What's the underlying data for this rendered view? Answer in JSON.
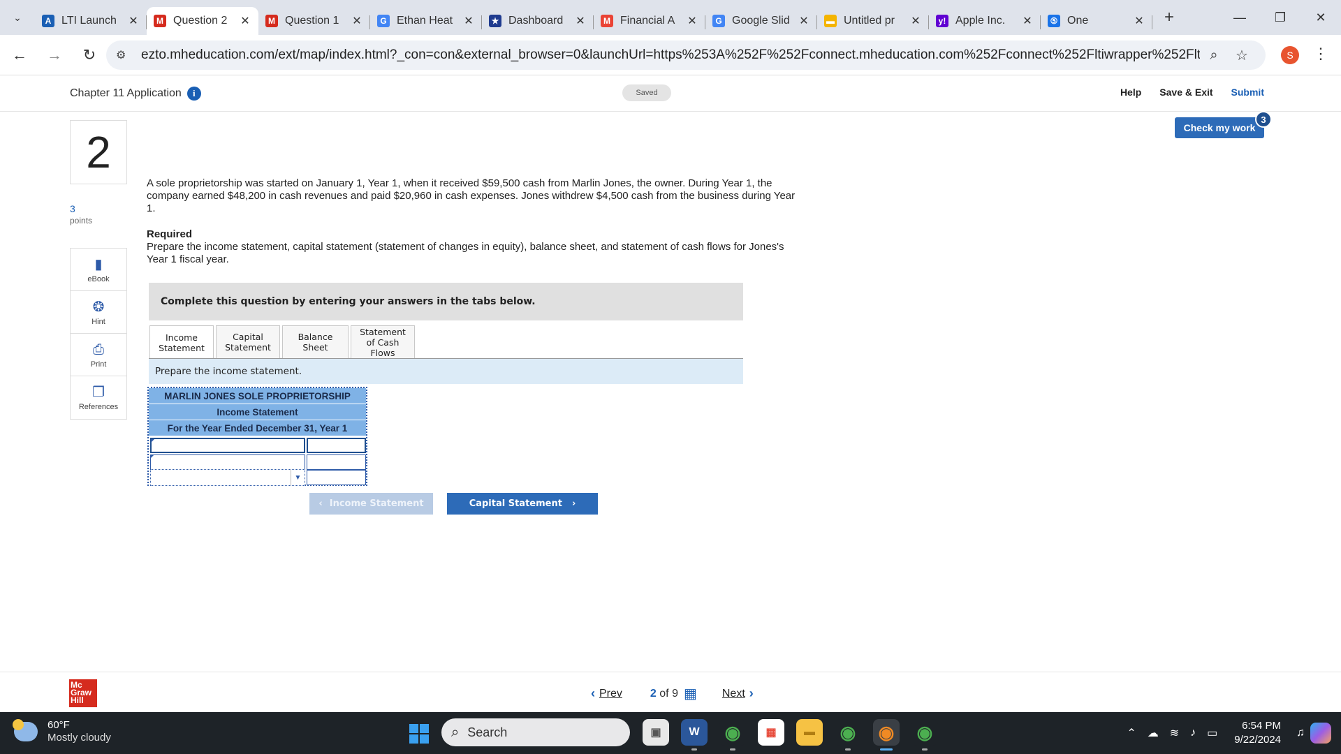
{
  "browser": {
    "tabs": [
      {
        "label": "LTI Launch",
        "icon": "lti-favicon",
        "color": "#1a5fb4",
        "glyph": "A",
        "active": false
      },
      {
        "label": "Question 2",
        "icon": "mheducation-favicon",
        "color": "#d52b1e",
        "glyph": "M",
        "active": true
      },
      {
        "label": "Question 1",
        "icon": "mheducation-favicon",
        "color": "#d52b1e",
        "glyph": "M",
        "active": false
      },
      {
        "label": "Ethan Heat",
        "icon": "google-favicon",
        "color": "#4285f4",
        "glyph": "G",
        "active": false
      },
      {
        "label": "Dashboard",
        "icon": "dashboard-favicon",
        "color": "#1f3b8f",
        "glyph": "★",
        "active": false
      },
      {
        "label": "Financial A",
        "icon": "gmail-favicon",
        "color": "#ea4335",
        "glyph": "M",
        "active": false
      },
      {
        "label": "Google Slid",
        "icon": "google-favicon",
        "color": "#4285f4",
        "glyph": "G",
        "active": false
      },
      {
        "label": "Untitled pr",
        "icon": "slides-favicon",
        "color": "#f4b400",
        "glyph": "▬",
        "active": false
      },
      {
        "label": "Apple Inc.",
        "icon": "yahoo-favicon",
        "color": "#6001d2",
        "glyph": "y!",
        "active": false
      },
      {
        "label": "One",
        "icon": "onelogin-favicon",
        "color": "#1a73e8",
        "glyph": "⑤",
        "active": false
      }
    ],
    "url": "ezto.mheducation.com/ext/map/index.html?_con=con&external_browser=0&launchUrl=https%253A%252F%252Fconnect.mheducation.com%252Fconnect%252Fltiwrapper%252FltiaCloseWindow....",
    "profile_initial": "S"
  },
  "header": {
    "assignment_title": "Chapter 11 Application",
    "saved_label": "Saved",
    "help_label": "Help",
    "save_exit_label": "Save & Exit",
    "submit_label": "Submit",
    "check_work_label": "Check my work",
    "check_work_count": "3"
  },
  "sidebar": {
    "question_number": "2",
    "points_value": "3",
    "points_label": "points",
    "tools": [
      {
        "label": "eBook",
        "icon": "book-icon"
      },
      {
        "label": "Hint",
        "icon": "lifebuoy-icon"
      },
      {
        "label": "Print",
        "icon": "printer-icon"
      },
      {
        "label": "References",
        "icon": "copy-icon"
      }
    ]
  },
  "question": {
    "prompt": "A sole proprietorship was started on January 1, Year 1, when it received $59,500 cash from Marlin Jones, the owner. During Year 1, the company earned $48,200 in cash revenues and paid $20,960 in cash expenses. Jones withdrew $4,500 cash from the business during Year 1.",
    "required_heading": "Required",
    "required_text": "Prepare the income statement, capital statement (statement of changes in equity), balance sheet, and statement of cash flows for Jones's Year 1 fiscal year.",
    "instruction": "Complete this question by entering your answers in the tabs below.",
    "tabs": [
      {
        "label": "Income Statement",
        "active": true
      },
      {
        "label": "Capital Statement",
        "active": false
      },
      {
        "label": "Balance Sheet",
        "active": false
      },
      {
        "label": "Statement of Cash Flows",
        "active": false
      }
    ],
    "tab_instruction": "Prepare the income statement.",
    "statement": {
      "company": "MARLIN JONES SOLE PROPRIETORSHIP",
      "title": "Income Statement",
      "period": "For the Year Ended December 31, Year 1"
    },
    "prev_button": "Income Statement",
    "next_button": "Capital Statement"
  },
  "footer": {
    "prev_label": "Prev",
    "current_page": "2",
    "of_label": "of",
    "total_pages": "9",
    "next_label": "Next",
    "logo_text": "Mc Graw Hill"
  },
  "taskbar": {
    "temperature": "60°F",
    "weather": "Mostly cloudy",
    "search_placeholder": "Search",
    "time": "6:54 PM",
    "date": "9/22/2024"
  }
}
